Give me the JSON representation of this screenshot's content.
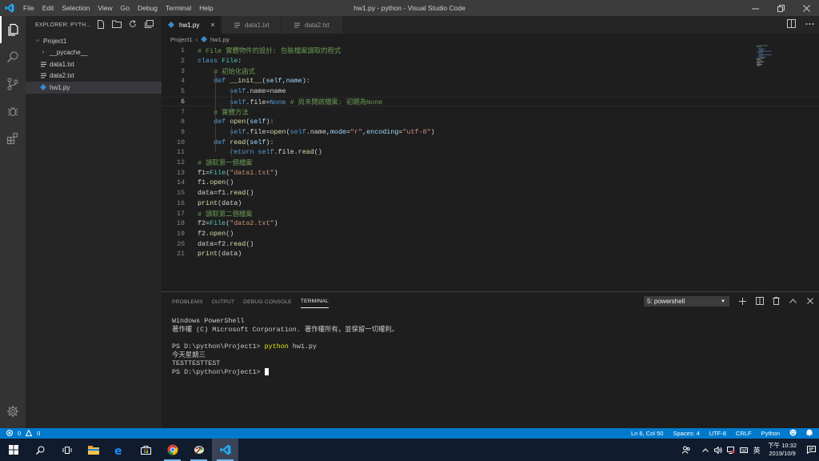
{
  "window": {
    "title": "hw1.py - python - Visual Studio Code",
    "menu": [
      "File",
      "Edit",
      "Selection",
      "View",
      "Go",
      "Debug",
      "Terminal",
      "Help"
    ]
  },
  "sidebar": {
    "header": "EXPLORER: PYTH...",
    "root": "Project1",
    "items": [
      {
        "label": "__pycache__",
        "type": "folder"
      },
      {
        "label": "data1.txt",
        "type": "text"
      },
      {
        "label": "data2.txt",
        "type": "text"
      },
      {
        "label": "hw1.py",
        "type": "python"
      }
    ]
  },
  "tabs": [
    {
      "label": "hw1.py",
      "icon": "python-icon",
      "active": true,
      "close": "×"
    },
    {
      "label": "data1.txt",
      "icon": "text-file-icon",
      "active": false
    },
    {
      "label": "data2.txt",
      "icon": "text-file-icon",
      "active": false
    }
  ],
  "breadcrumb": {
    "folder": "Project1",
    "sep": "›",
    "file": "hw1.py"
  },
  "editor": {
    "current_line": 6,
    "lines": [
      {
        "n": "1",
        "tokens": [
          {
            "t": "# File 實體物件的設計: 包裝檔案讀取的程式",
            "c": "cm"
          }
        ]
      },
      {
        "n": "2",
        "tokens": [
          {
            "t": "class",
            "c": "kw"
          },
          {
            "t": " ",
            "c": "pl"
          },
          {
            "t": "File",
            "c": "cl"
          },
          {
            "t": ":",
            "c": "pl"
          }
        ]
      },
      {
        "n": "3",
        "tokens": [
          {
            "t": "    ",
            "c": "pl"
          },
          {
            "t": "# 初始化函式",
            "c": "cm"
          }
        ]
      },
      {
        "n": "4",
        "tokens": [
          {
            "t": "    ",
            "c": "pl"
          },
          {
            "t": "def",
            "c": "kw"
          },
          {
            "t": " ",
            "c": "pl"
          },
          {
            "t": "__init__",
            "c": "fn"
          },
          {
            "t": "(",
            "c": "pl"
          },
          {
            "t": "self",
            "c": "pa"
          },
          {
            "t": ",",
            "c": "pl"
          },
          {
            "t": "name",
            "c": "pa"
          },
          {
            "t": "):",
            "c": "pl"
          }
        ]
      },
      {
        "n": "5",
        "tokens": [
          {
            "t": "        ",
            "c": "pl"
          },
          {
            "t": "self",
            "c": "kw"
          },
          {
            "t": ".name=name",
            "c": "pl"
          }
        ]
      },
      {
        "n": "6",
        "tokens": [
          {
            "t": "        ",
            "c": "pl"
          },
          {
            "t": "self",
            "c": "kw"
          },
          {
            "t": ".file=",
            "c": "pl"
          },
          {
            "t": "None",
            "c": "kw"
          },
          {
            "t": " ",
            "c": "pl"
          },
          {
            "t": "# 尚未開啟檔案: 初期為None",
            "c": "cm"
          }
        ]
      },
      {
        "n": "7",
        "tokens": [
          {
            "t": "    ",
            "c": "pl"
          },
          {
            "t": "# 實體方法",
            "c": "cm"
          }
        ]
      },
      {
        "n": "8",
        "tokens": [
          {
            "t": "    ",
            "c": "pl"
          },
          {
            "t": "def",
            "c": "kw"
          },
          {
            "t": " ",
            "c": "pl"
          },
          {
            "t": "open",
            "c": "fn"
          },
          {
            "t": "(",
            "c": "pl"
          },
          {
            "t": "self",
            "c": "pa"
          },
          {
            "t": "):",
            "c": "pl"
          }
        ]
      },
      {
        "n": "9",
        "tokens": [
          {
            "t": "        ",
            "c": "pl"
          },
          {
            "t": "self",
            "c": "kw"
          },
          {
            "t": ".file=",
            "c": "pl"
          },
          {
            "t": "open",
            "c": "fn"
          },
          {
            "t": "(",
            "c": "pl"
          },
          {
            "t": "self",
            "c": "kw"
          },
          {
            "t": ".name,",
            "c": "pl"
          },
          {
            "t": "mode",
            "c": "pa"
          },
          {
            "t": "=",
            "c": "pl"
          },
          {
            "t": "\"r\"",
            "c": "st"
          },
          {
            "t": ",",
            "c": "pl"
          },
          {
            "t": "encoding",
            "c": "pa"
          },
          {
            "t": "=",
            "c": "pl"
          },
          {
            "t": "\"utf-8\"",
            "c": "st"
          },
          {
            "t": ")",
            "c": "pl"
          }
        ]
      },
      {
        "n": "10",
        "tokens": [
          {
            "t": "    ",
            "c": "pl"
          },
          {
            "t": "def",
            "c": "kw"
          },
          {
            "t": " ",
            "c": "pl"
          },
          {
            "t": "read",
            "c": "fn"
          },
          {
            "t": "(",
            "c": "pl"
          },
          {
            "t": "self",
            "c": "pa"
          },
          {
            "t": "):",
            "c": "pl"
          }
        ]
      },
      {
        "n": "11",
        "tokens": [
          {
            "t": "        ",
            "c": "pl"
          },
          {
            "t": "return",
            "c": "kw"
          },
          {
            "t": " ",
            "c": "pl"
          },
          {
            "t": "self",
            "c": "kw"
          },
          {
            "t": ".file.",
            "c": "pl"
          },
          {
            "t": "read",
            "c": "fn"
          },
          {
            "t": "()",
            "c": "pl"
          }
        ]
      },
      {
        "n": "12",
        "tokens": [
          {
            "t": "# 讀取第一個檔案",
            "c": "cm"
          }
        ]
      },
      {
        "n": "13",
        "tokens": [
          {
            "t": "f1=",
            "c": "pl"
          },
          {
            "t": "File",
            "c": "cl"
          },
          {
            "t": "(",
            "c": "pl"
          },
          {
            "t": "\"data1.txt\"",
            "c": "st"
          },
          {
            "t": ")",
            "c": "pl"
          }
        ]
      },
      {
        "n": "14",
        "tokens": [
          {
            "t": "f1.",
            "c": "pl"
          },
          {
            "t": "open",
            "c": "fn"
          },
          {
            "t": "()",
            "c": "pl"
          }
        ]
      },
      {
        "n": "15",
        "tokens": [
          {
            "t": "data=f1.",
            "c": "pl"
          },
          {
            "t": "read",
            "c": "fn"
          },
          {
            "t": "()",
            "c": "pl"
          }
        ]
      },
      {
        "n": "16",
        "tokens": [
          {
            "t": "print",
            "c": "fn"
          },
          {
            "t": "(data)",
            "c": "pl"
          }
        ]
      },
      {
        "n": "17",
        "tokens": [
          {
            "t": "# 讀取第二個檔案",
            "c": "cm"
          }
        ]
      },
      {
        "n": "18",
        "tokens": [
          {
            "t": "f2=",
            "c": "pl"
          },
          {
            "t": "File",
            "c": "cl"
          },
          {
            "t": "(",
            "c": "pl"
          },
          {
            "t": "\"data2.txt\"",
            "c": "st"
          },
          {
            "t": ")",
            "c": "pl"
          }
        ]
      },
      {
        "n": "19",
        "tokens": [
          {
            "t": "f2.",
            "c": "pl"
          },
          {
            "t": "open",
            "c": "fn"
          },
          {
            "t": "()",
            "c": "pl"
          }
        ]
      },
      {
        "n": "20",
        "tokens": [
          {
            "t": "data=f2.",
            "c": "pl"
          },
          {
            "t": "read",
            "c": "fn"
          },
          {
            "t": "()",
            "c": "pl"
          }
        ]
      },
      {
        "n": "21",
        "tokens": [
          {
            "t": "print",
            "c": "fn"
          },
          {
            "t": "(data)",
            "c": "pl"
          }
        ]
      }
    ]
  },
  "panel": {
    "tabs": [
      "PROBLEMS",
      "OUTPUT",
      "DEBUG CONSOLE",
      "TERMINAL"
    ],
    "active_tab": "TERMINAL",
    "terminal_select": "5: powershell",
    "terminal_lines": [
      {
        "text": "Windows PowerShell"
      },
      {
        "text": "著作權 (C) Microsoft Corporation. 著作權所有，並保留一切權利。"
      },
      {
        "text": ""
      },
      {
        "prompt": "PS D:\\python\\Project1> ",
        "cmd": "python",
        "args": " hw1.py"
      },
      {
        "text": "今天星期三"
      },
      {
        "text": "TESTTESTTEST"
      },
      {
        "prompt": "PS D:\\python\\Project1> ",
        "cursor": true
      }
    ]
  },
  "statusbar": {
    "errors": "0",
    "warnings": "0",
    "position": "Ln 6, Col 50",
    "spaces": "Spaces: 4",
    "encoding": "UTF-8",
    "eol": "CRLF",
    "language": "Python"
  },
  "taskbar": {
    "ime": "英",
    "time": "下午 10:32",
    "date": "2019/10/9"
  },
  "colors": {
    "accent": "#007acc",
    "titlebar": "#3c3c3c",
    "activitybar": "#333333",
    "sidebar": "#252526",
    "editor_bg": "#1e1e1e"
  }
}
